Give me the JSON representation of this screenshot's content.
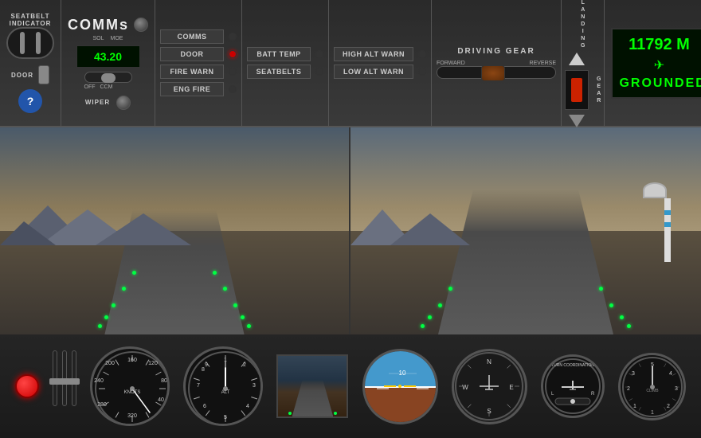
{
  "topPanel": {
    "seatbelt": {
      "label": "SEATBELT",
      "label2": "INDICATOR",
      "door_label": "DOOR"
    },
    "comms": {
      "title": "COMMs",
      "display_value": "43.20",
      "wiper_label": "WIPER",
      "sol_label": "SOL",
      "mode_label": "MOE",
      "off_label": "OFF",
      "ccm_label": "CCM"
    },
    "warnings": {
      "comms_label": "COMMS",
      "door_label": "DOOR",
      "fire_warn_label": "FIRE WARN",
      "eng_fire_label": "ENG FIRE",
      "batt_temp_label": "BATT TEMP",
      "seatbelts_label": "SEATBELTS",
      "high_alt_warn": "HIGH ALT WARN",
      "low_alt_warn": "LOW ALT WARN"
    },
    "drivingGear": {
      "title": "DRIVING GEAR",
      "forward_label": "FORWARD",
      "reverse_label": "REVERSE"
    },
    "landingGear": {
      "label": "LANDING GEAR"
    },
    "altitude": {
      "value": "11792 M",
      "status": "GROUNDED"
    }
  },
  "instruments": {
    "speed_label": "KNOTS",
    "alt_label": "ALT",
    "turn_label": "TURN COORDINATION",
    "climb_label": "CLIMB",
    "speed_value": "0",
    "alt_value": "0"
  }
}
